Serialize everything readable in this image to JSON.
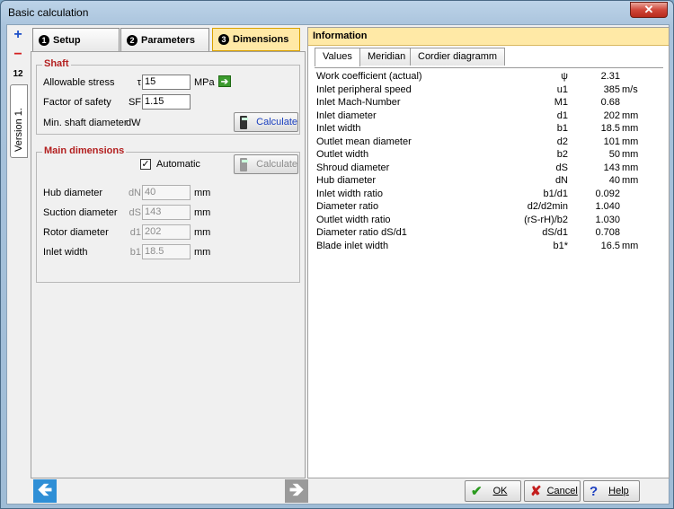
{
  "window": {
    "title": "Basic calculation",
    "close_label": "✕"
  },
  "side": {
    "add": "+",
    "remove": "−",
    "number": "12",
    "version_tab": "Version 1."
  },
  "steps": [
    {
      "num": "1",
      "label": "Setup"
    },
    {
      "num": "2",
      "label": "Parameters"
    },
    {
      "num": "3",
      "label": "Dimensions"
    }
  ],
  "shaft": {
    "title": "Shaft",
    "stress_label": "Allowable stress",
    "stress_sym": "τ",
    "stress_value": "15",
    "stress_unit": "MPa",
    "safety_label": "Factor of safety",
    "safety_sym": "SF",
    "safety_value": "1.15",
    "diam_label": "Min. shaft diameter",
    "diam_sym": "dW",
    "calc_label": "Calculate"
  },
  "main_dims": {
    "title": "Main dimensions",
    "auto_label": "Automatic",
    "auto_checked": "✓",
    "calc_label": "Calculate",
    "fields": [
      {
        "label": "Hub diameter",
        "sym": "dN",
        "value": "40",
        "unit": "mm"
      },
      {
        "label": "Suction diameter",
        "sym": "dS",
        "value": "143",
        "unit": "mm"
      },
      {
        "label": "Rotor diameter",
        "sym": "d1",
        "value": "202",
        "unit": "mm"
      },
      {
        "label": "Inlet width",
        "sym": "b1",
        "value": "18.5",
        "unit": "mm"
      }
    ]
  },
  "info": {
    "title": "Information",
    "tabs": [
      "Values",
      "Meridian",
      "Cordier diagramm"
    ],
    "rows": [
      {
        "name": "Work coefficient (actual)",
        "sym": "ψ",
        "val": "2.31",
        "unit": ""
      },
      {
        "name": "Inlet peripheral speed",
        "sym": "u1",
        "val": "385",
        "unit": "m/s"
      },
      {
        "name": "Inlet Mach-Number",
        "sym": "M1",
        "val": "0.68",
        "unit": ""
      },
      {
        "name": "Inlet diameter",
        "sym": "d1",
        "val": "202",
        "unit": "mm"
      },
      {
        "name": "Inlet width",
        "sym": "b1",
        "val": "18.5",
        "unit": "mm"
      },
      {
        "name": "Outlet mean diameter",
        "sym": "d2",
        "val": "101",
        "unit": "mm"
      },
      {
        "name": "Outlet width",
        "sym": "b2",
        "val": "50",
        "unit": "mm"
      },
      {
        "name": "Shroud diameter",
        "sym": "dS",
        "val": "143",
        "unit": "mm"
      },
      {
        "name": "Hub diameter",
        "sym": "dN",
        "val": "40",
        "unit": "mm"
      },
      {
        "name": "Inlet width ratio",
        "sym": "b1/d1",
        "val": "0.092",
        "unit": ""
      },
      {
        "name": "Diameter ratio",
        "sym": "d2/d2min",
        "val": "1.040",
        "unit": ""
      },
      {
        "name": "Outlet width ratio",
        "sym": "(rS-rH)/b2",
        "val": "1.030",
        "unit": ""
      },
      {
        "name": "Diameter ratio dS/d1",
        "sym": "dS/d1",
        "val": "0.708",
        "unit": ""
      },
      {
        "name": "Blade inlet width",
        "sym": "b1*",
        "val": "16.5",
        "unit": "mm"
      }
    ]
  },
  "buttons": {
    "back": "🡸",
    "forward": "🡺",
    "ok": "OK",
    "cancel": "Cancel",
    "help": "Help"
  }
}
